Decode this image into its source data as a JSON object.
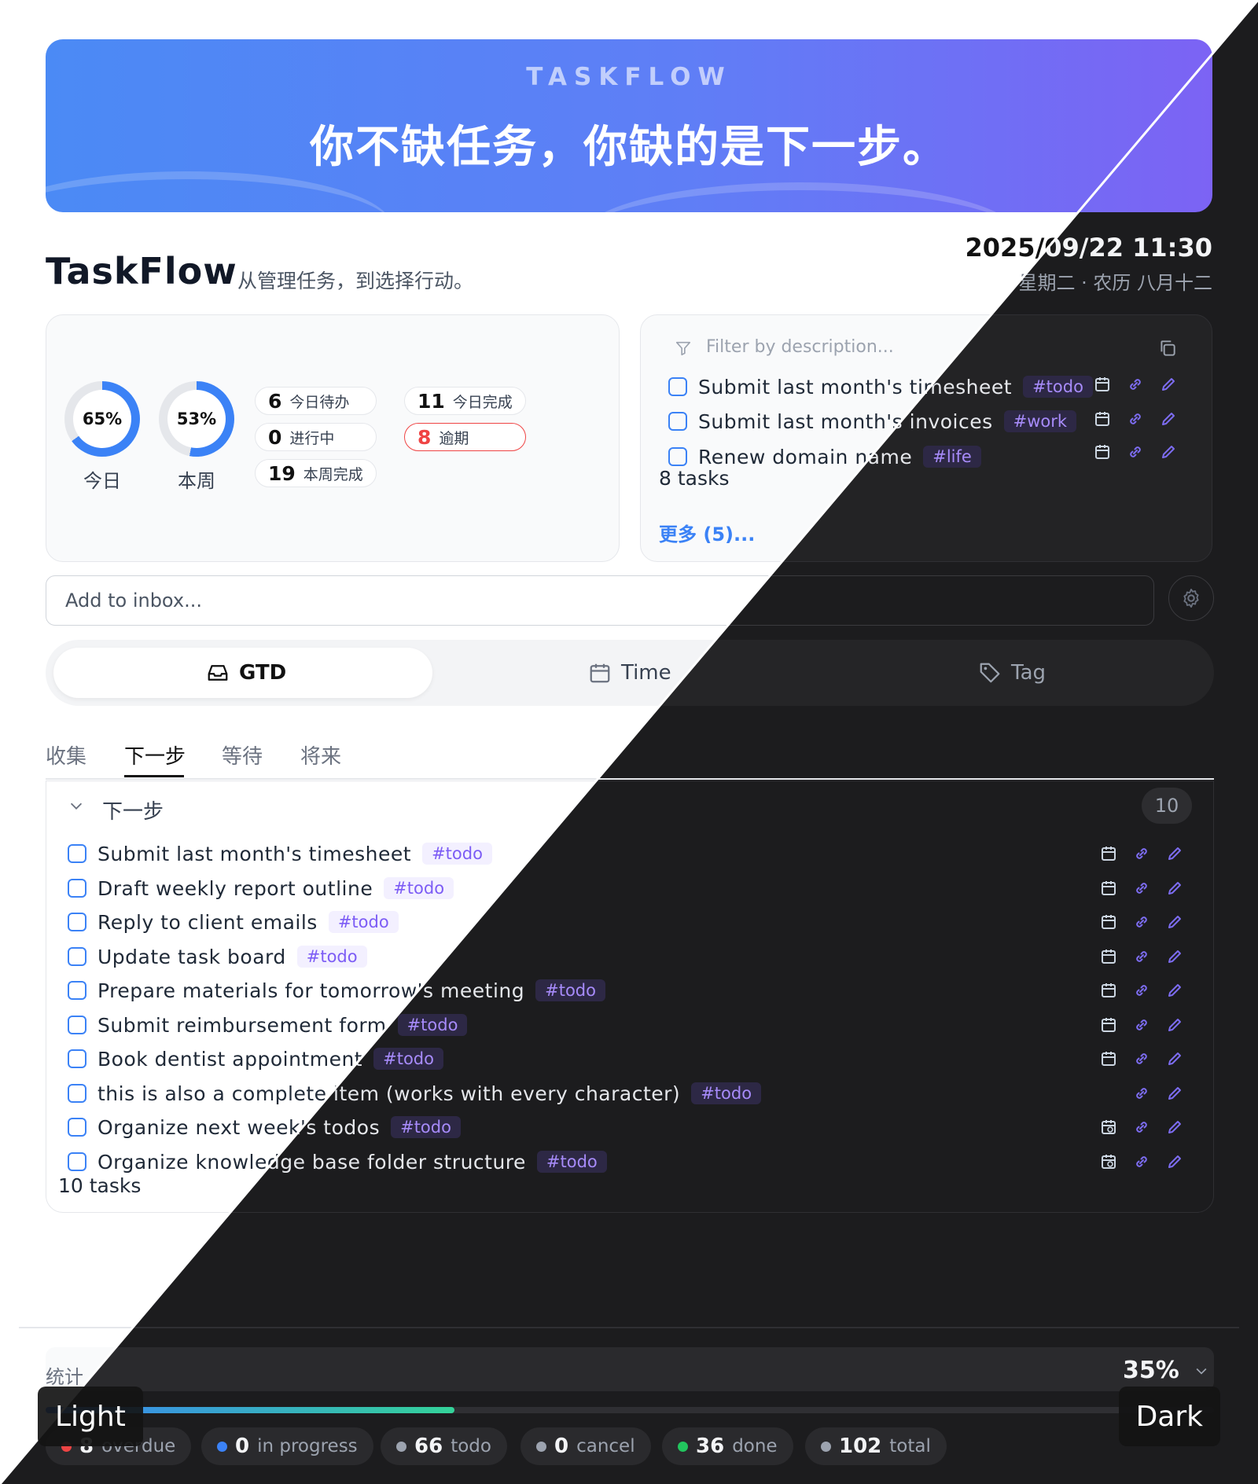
{
  "banner": {
    "brand": "TASKFLOW",
    "slogan": "你不缺任务，你缺的是下一步。"
  },
  "app": {
    "title": "TaskFlow",
    "subtitle": "从管理任务，到选择行动。"
  },
  "datetime": {
    "time": "2025/09/22 11:30",
    "lunar": "星期二 · 农历 八月十二"
  },
  "rings": [
    {
      "percent": "65%",
      "value": 0.65,
      "label": "今日"
    },
    {
      "percent": "53%",
      "value": 0.53,
      "label": "本周"
    }
  ],
  "counters": [
    {
      "num": "6",
      "label": "今日待办"
    },
    {
      "num": "11",
      "label": "今日完成"
    },
    {
      "num": "0",
      "label": "进行中"
    },
    {
      "num": "8",
      "label": "逾期"
    },
    {
      "num": "19",
      "label": "本周完成"
    }
  ],
  "filter": {
    "placeholder": "Filter by description...",
    "tasks": [
      {
        "text": "Submit last month's timesheet",
        "tag": "#todo"
      },
      {
        "text": "Submit last month's invoices",
        "tag": "#work"
      },
      {
        "text": "Renew domain name",
        "tag": "#life"
      }
    ],
    "count": "8 tasks",
    "more": "更多 (5)..."
  },
  "inbox": {
    "placeholder": "Add to inbox..."
  },
  "views": [
    {
      "label": "GTD",
      "icon": "inbox-icon"
    },
    {
      "label": "Time",
      "icon": "calendar-icon"
    },
    {
      "label": "Tag",
      "icon": "tag-icon"
    }
  ],
  "subtabs": [
    "收集",
    "下一步",
    "等待",
    "将来"
  ],
  "group": {
    "title": "下一步",
    "count": "10",
    "tasks": [
      {
        "text": "Submit last month's timesheet",
        "tag": "#todo",
        "date_icon": "calendar-icon"
      },
      {
        "text": "Draft weekly report outline",
        "tag": "#todo",
        "date_icon": "calendar-icon"
      },
      {
        "text": "Reply to client emails",
        "tag": "#todo",
        "date_icon": "calendar-icon"
      },
      {
        "text": "Update task board",
        "tag": "#todo",
        "date_icon": "calendar-icon"
      },
      {
        "text": "Prepare materials for tomorrow's meeting",
        "tag": "#todo",
        "date_icon": "calendar-icon"
      },
      {
        "text": "Submit reimbursement form",
        "tag": "#todo",
        "date_icon": "calendar-icon"
      },
      {
        "text": "Book dentist appointment",
        "tag": "#todo",
        "date_icon": "calendar-icon"
      },
      {
        "text": "this is also a complete item (works with every character)",
        "tag": "#todo",
        "date_icon": ""
      },
      {
        "text": "Organize next week's todos",
        "tag": "#todo",
        "date_icon": "calendar-repeat-icon"
      },
      {
        "text": "Organize knowledge base folder structure",
        "tag": "#todo",
        "date_icon": "calendar-repeat-icon"
      }
    ],
    "footer": "10 tasks"
  },
  "stats": {
    "label": "统计",
    "percent": "35%",
    "progress": 0.35,
    "chips": [
      {
        "num": "8",
        "label": "overdue",
        "color": "#ef4444"
      },
      {
        "num": "0",
        "label": "in progress",
        "color": "#3b82f6"
      },
      {
        "num": "66",
        "label": "todo",
        "color": "#9ca3af"
      },
      {
        "num": "0",
        "label": "cancel",
        "color": "#9ca3af"
      },
      {
        "num": "36",
        "label": "done",
        "color": "#22c55e"
      },
      {
        "num": "102",
        "label": "total",
        "color": "#9ca3af"
      }
    ]
  },
  "modes": {
    "light": "Light",
    "dark": "Dark"
  },
  "colors": {
    "accent": "#3b82f6",
    "tag": "#7c5cf5",
    "overdue": "#ef4444",
    "banner_start": "#4b8af5",
    "banner_end": "#7c63f4"
  }
}
